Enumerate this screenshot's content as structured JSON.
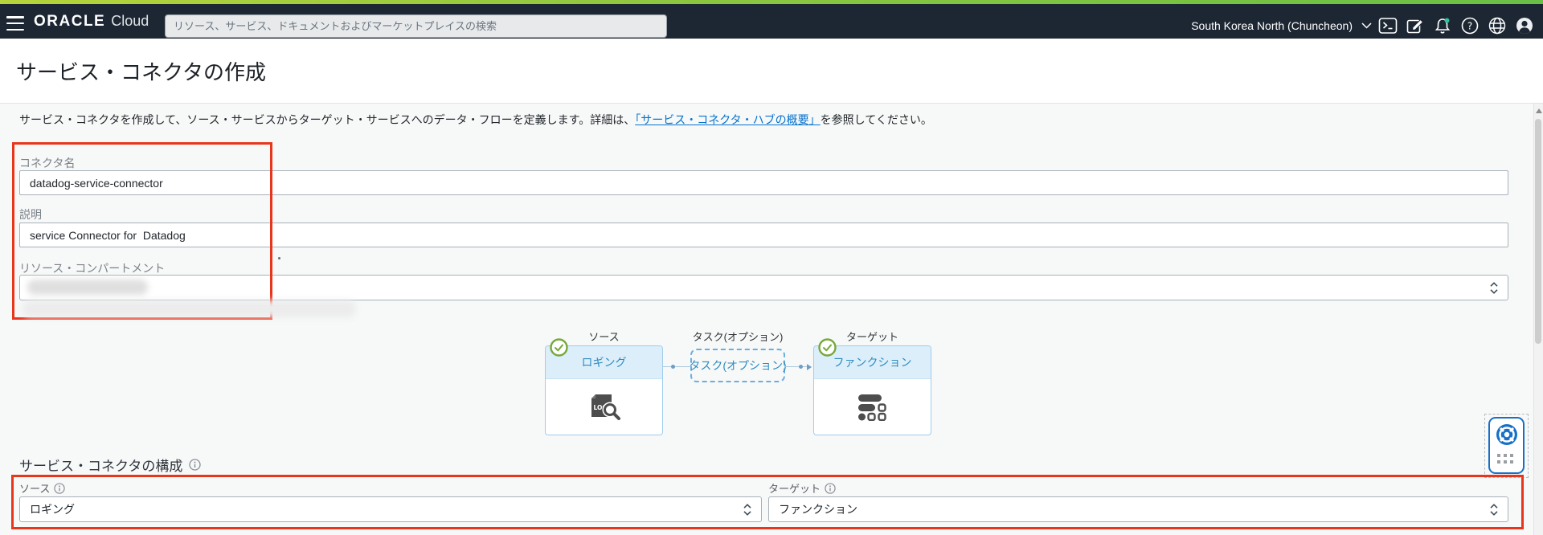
{
  "header": {
    "logo_oracle": "ORACLE",
    "logo_cloud": "Cloud",
    "search_placeholder": "リソース、サービス、ドキュメントおよびマーケットプレイスの検索",
    "region": "South Korea North (Chuncheon)",
    "icons": [
      "cloud-shell-icon",
      "announcements-icon",
      "notifications-bell-icon",
      "help-icon",
      "language-globe-icon",
      "user-avatar-icon"
    ]
  },
  "page": {
    "title": "サービス・コネクタの作成",
    "intro_before_link": "サービス・コネクタを作成して、ソース・サービスからターゲット・サービスへのデータ・フローを定義します。詳細は、",
    "intro_link": "「サービス・コネクタ・ハブの概要」",
    "intro_after_link": "を参照してください。"
  },
  "form": {
    "connector_name_label": "コネクタ名",
    "connector_name_value": "datadog-service-connector",
    "description_label": "説明",
    "description_value": "service Connector for  Datadog",
    "compartment_label": "リソース・コンパートメント",
    "compartment_value_redacted": true
  },
  "diagram": {
    "source_label": "ソース",
    "task_label": "タスク(オプション)",
    "target_label": "ターゲット",
    "source_card": "ロギング",
    "task_card": "タスク(オプション)",
    "target_card": "ファンクション",
    "source_icon_text": "LOGS"
  },
  "config": {
    "heading": "サービス・コネクタの構成",
    "source_label": "ソース",
    "source_value": "ロギング",
    "target_label": "ターゲット",
    "target_value": "ファンクション"
  },
  "colors": {
    "annotation_red": "#e8361d",
    "header_bg": "#1d2733",
    "link_blue": "#0572ce",
    "card_blue_text": "#2f8cbf",
    "check_green": "#76a83a",
    "widget_blue": "#1770c7",
    "bell_dot_teal": "#2ec4a0"
  }
}
